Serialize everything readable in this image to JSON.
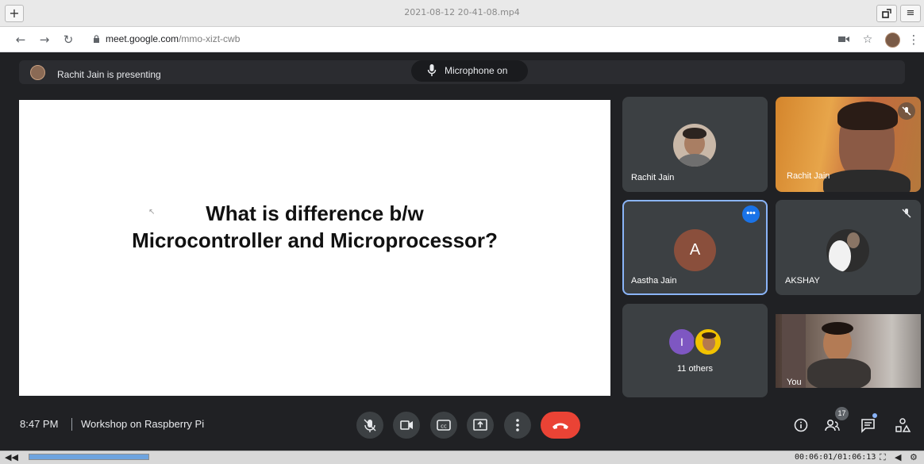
{
  "player": {
    "new_tab": "+",
    "file_title": "2021-08-12 20-41-08.mp4",
    "restore_icon": "restore-icon",
    "menu_icon": "hamburger-menu-icon",
    "time_display": "00:06:01/01:06:13"
  },
  "browser": {
    "url_host": "meet.google.com",
    "url_path": "/mmo-xizt-cwb"
  },
  "meet": {
    "presenting_text": "Rachit Jain is presenting",
    "microphone_text": "Microphone on",
    "slide_title": "What is difference b/w\nMicrocontroller and Microprocessor?",
    "tiles": {
      "rachit_1": "Rachit Jain",
      "rachit_2": "Rachit Jain",
      "aastha": "Aastha Jain",
      "aastha_initial": "A",
      "akshay": "AKSHAY",
      "others_initial": "I",
      "others": "11 others",
      "you": "You"
    },
    "time": "8:47 PM",
    "meeting_title": "Workshop on Raspberry Pi",
    "participants_count": "17",
    "accent_color": "#8ab4f8",
    "hangup_color": "#ea4335"
  }
}
